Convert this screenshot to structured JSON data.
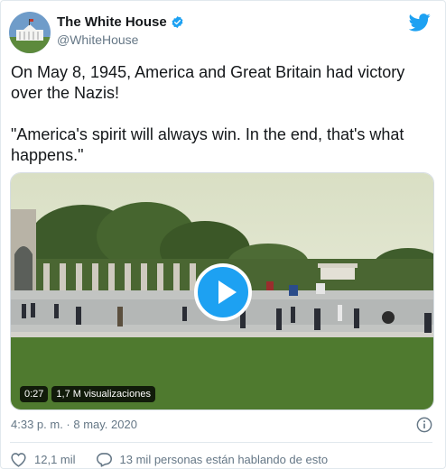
{
  "account": {
    "name": "The White House",
    "handle": "@WhiteHouse"
  },
  "tweet": {
    "line1": "On May 8, 1945, America and Great Britain had victory over the Nazis!",
    "line2": "\"America's spirit will always win. In the end, that's what happens.\""
  },
  "video": {
    "duration": "0:27",
    "views": "1,7 M visualizaciones"
  },
  "timestamp": "4:33 p. m. · 8 may. 2020",
  "actions": {
    "likes": "12,1 mil",
    "talking": "13 mil personas están hablando de esto"
  },
  "icons": [
    "avatar",
    "verified-badge-icon",
    "twitter-bird-icon",
    "play-icon",
    "info-icon",
    "heart-icon",
    "comment-icon"
  ],
  "colors": {
    "brand": "#1da1f2",
    "text": "#14171a",
    "muted": "#657786"
  }
}
